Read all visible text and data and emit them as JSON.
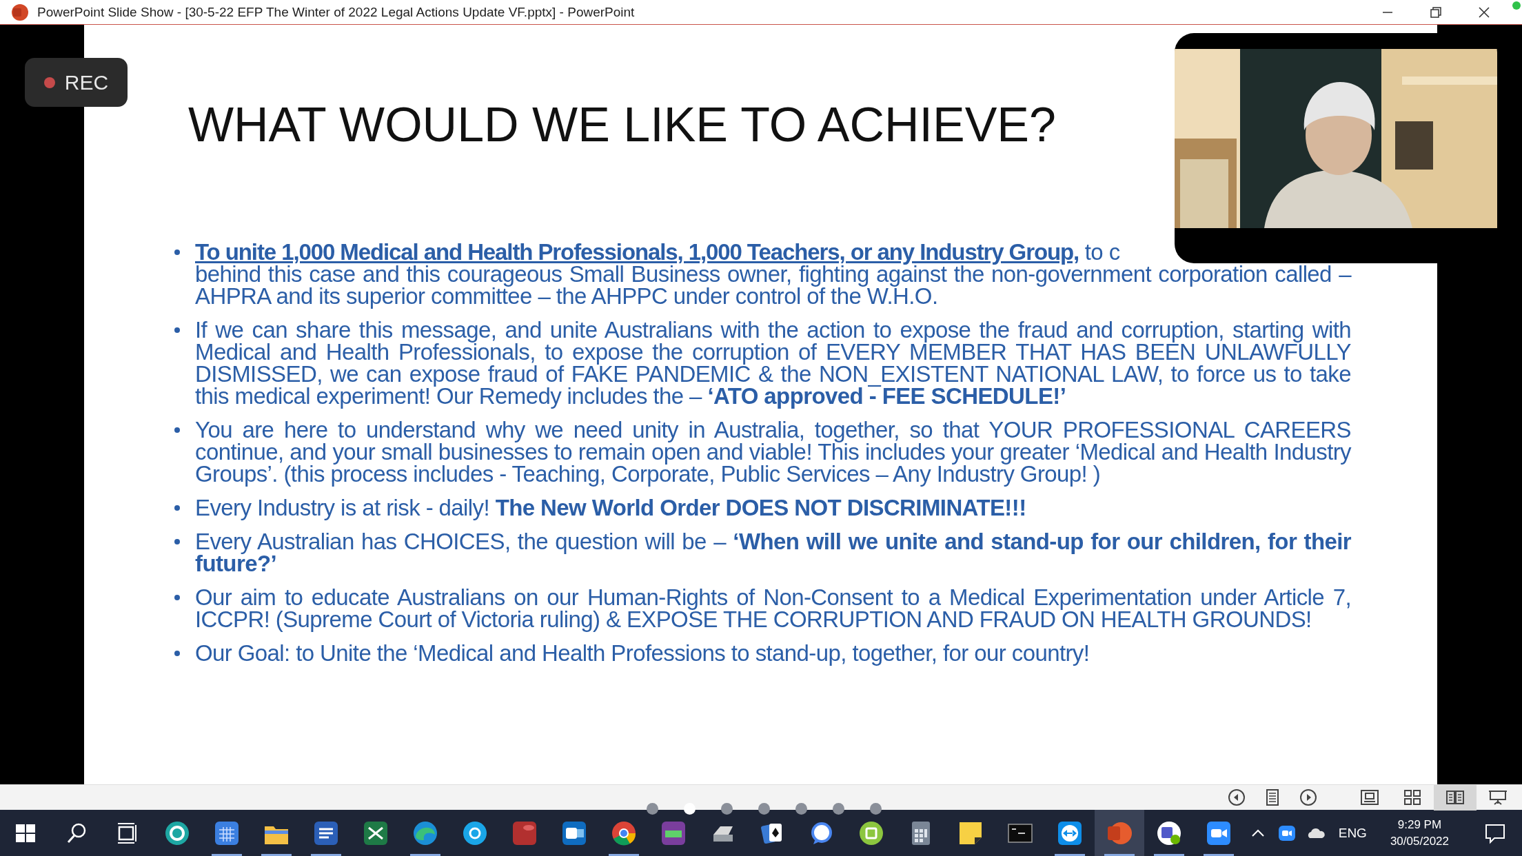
{
  "window": {
    "title": "PowerPoint Slide Show - [30-5-22 EFP The Winter of 2022 Legal Actions Update VF.pptx] - PowerPoint"
  },
  "recording": {
    "label": "REC"
  },
  "slide": {
    "title": "WHAT WOULD WE LIKE TO ACHIEVE?",
    "bullets": [
      {
        "kind": "covered",
        "lead": "**To unite 1,000 Medical and Health Professionals, 1,000 Teachers, or any Industry Group,** to c",
        "text": "behind this case and this courageous Small Business owner, fighting against the non-government corporation called – AHPRA and its superior committee – the AHPPC under control of the W.H.O."
      },
      {
        "kind": "plain",
        "text": "If we can share this message, and unite Australians with the action to expose the fraud and corruption, starting with Medical and Health Professionals, to expose the corruption of EVERY MEMBER THAT HAS BEEN UNLAWFULLY DISMISSED, we can expose fraud of FAKE PANDEMIC & the NON_EXISTENT NATIONAL LAW, to force us to take this medical experiment! Our Remedy includes the – **‘ATO approved - FEE SCHEDULE!’**"
      },
      {
        "kind": "plain",
        "text": "You are here to understand why we need unity in Australia,  together, so that YOUR PROFESSIONAL CAREERS continue, and your small businesses to remain open and viable! This includes your greater ‘Medical and Health Industry Groups’. (this process includes - Teaching, Corporate, Public Services – Any Industry Group! )"
      },
      {
        "kind": "plain",
        "text": "Every Industry is at risk - daily! **The New World Order DOES NOT DISCRIMINATE!!!**"
      },
      {
        "kind": "plain",
        "text": "Every Australian has CHOICES, the question will be – **‘When will we unite and stand-up for our children, for their future?’**"
      },
      {
        "kind": "plain",
        "text": "Our aim to educate Australians on our Human-Rights of Non-Consent to a Medical Experimentation under Article 7, ICCPR! (Supreme Court of Victoria ruling) & EXPOSE THE CORRUPTION AND FRAUD ON HEALTH GROUNDS!"
      },
      {
        "kind": "plain",
        "text": "Our Goal: to Unite the ‘Medical and Health Professions to stand-up, together, for our country!"
      }
    ]
  },
  "slideshow_bar": {
    "views": [
      {
        "kind": "normal",
        "selected": false
      },
      {
        "kind": "sorter",
        "selected": false
      },
      {
        "kind": "reading",
        "selected": true
      },
      {
        "kind": "slideshow",
        "selected": false
      }
    ]
  },
  "page_dots": [
    {
      "selected": false
    },
    {
      "selected": true
    },
    {
      "selected": false
    },
    {
      "selected": false
    },
    {
      "selected": false
    },
    {
      "selected": false
    },
    {
      "selected": false
    }
  ],
  "taskbar": {
    "apps": [
      {
        "kind": "start",
        "running": false,
        "active": false
      },
      {
        "kind": "search",
        "running": false,
        "active": false
      },
      {
        "kind": "taskview",
        "running": false,
        "active": false
      },
      {
        "kind": "eset",
        "running": false,
        "active": false
      },
      {
        "kind": "calendar",
        "running": true,
        "active": false
      },
      {
        "kind": "explorer",
        "running": true,
        "active": false
      },
      {
        "kind": "word",
        "running": true,
        "active": false
      },
      {
        "kind": "excel",
        "running": false,
        "active": false
      },
      {
        "kind": "edge",
        "running": true,
        "active": false
      },
      {
        "kind": "skype",
        "running": false,
        "active": false
      },
      {
        "kind": "access",
        "running": false,
        "active": false
      },
      {
        "kind": "outlook",
        "running": false,
        "active": false
      },
      {
        "kind": "chrome",
        "running": true,
        "active": false
      },
      {
        "kind": "scanner",
        "running": false,
        "active": false
      },
      {
        "kind": "printer",
        "running": false,
        "active": false
      },
      {
        "kind": "solitaire",
        "running": false,
        "active": false
      },
      {
        "kind": "signal",
        "running": false,
        "active": false
      },
      {
        "kind": "greenapp",
        "running": false,
        "active": false
      },
      {
        "kind": "calculator",
        "running": false,
        "active": false
      },
      {
        "kind": "sticky",
        "running": false,
        "active": false
      },
      {
        "kind": "terminal",
        "running": false,
        "active": false
      },
      {
        "kind": "teamviewer",
        "running": true,
        "active": false
      },
      {
        "kind": "powerpoint",
        "running": true,
        "active": true
      },
      {
        "kind": "teams",
        "running": true,
        "active": false
      },
      {
        "kind": "zoom",
        "running": true,
        "active": false
      }
    ],
    "tray": {
      "language": "ENG",
      "time": "9:29 PM",
      "date": "30/05/2022"
    }
  }
}
